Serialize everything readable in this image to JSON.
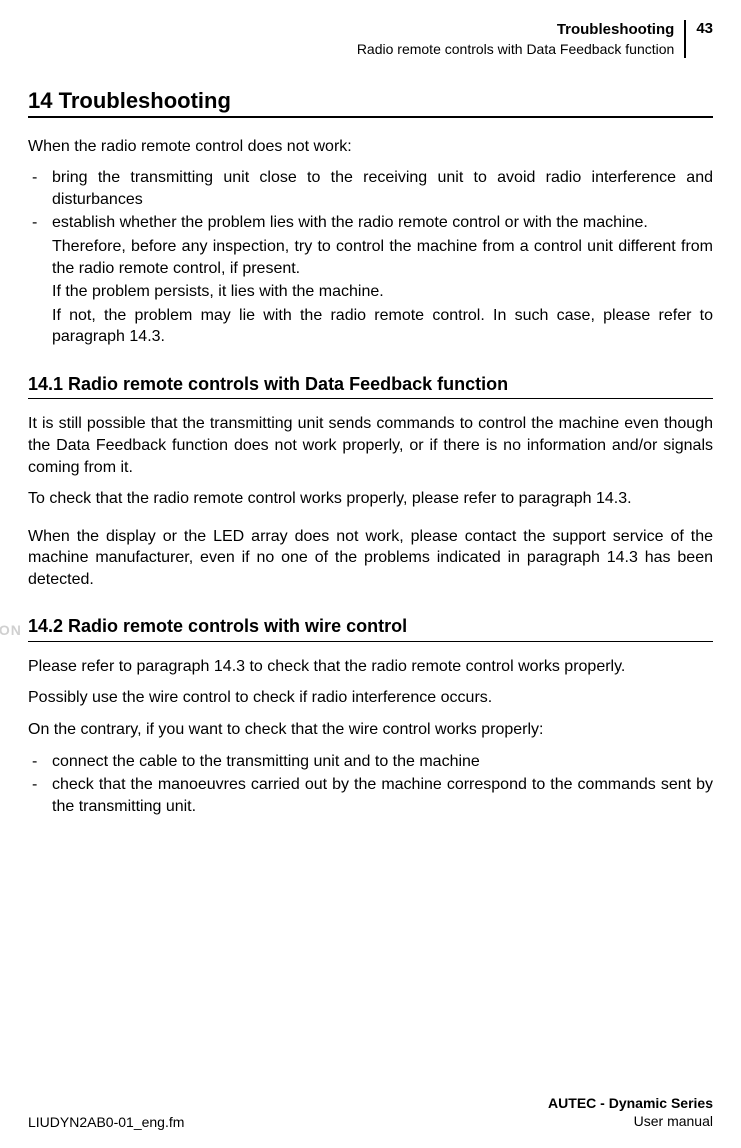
{
  "header": {
    "title": "Troubleshooting",
    "subtitle": "Radio remote controls with Data Feedback function",
    "page_number": "43"
  },
  "section": {
    "number": "14",
    "title": "Troubleshooting",
    "intro": "When the radio remote control does not work:",
    "bullets": [
      {
        "text": "bring the transmitting unit close to the receiving unit to avoid radio interference and disturbances"
      },
      {
        "text": "establish whether the problem lies with the radio remote control or with the machine.",
        "subs": [
          "Therefore, before any inspection, try to control the machine from a control unit different from the radio remote control, if present.",
          "If the problem persists, it lies with the machine.",
          "If not, the problem may lie with the radio remote control. In such case, please refer to paragraph 14.3."
        ]
      }
    ]
  },
  "sub1": {
    "heading": "14.1 Radio remote controls with Data Feedback function",
    "p1": "It is still possible that the transmitting unit sends commands to control the machine even though the Data Feedback function does not work properly, or if there is no information and/or signals coming from it.",
    "p2": "To check that the radio remote control works properly, please refer to paragraph 14.3.",
    "p3": "When the display or the LED array does not work, please contact the support service of the machine manufacturer, even if no one of the problems indicated in paragraph 14.3 has been detected."
  },
  "sub2": {
    "heading": "14.2 Radio remote controls with wire control",
    "p1": "Please refer to paragraph 14.3 to check that the radio remote control works properly.",
    "p2": "Possibly use the wire control to check if radio interference occurs.",
    "p3": "On the contrary, if you want to check that the wire control works properly:",
    "bullets": [
      "connect the cable to the transmitting unit and to the machine",
      "check that the manoeuvres carried out by the machine correspond to the commands sent by the transmitting unit."
    ]
  },
  "watermark": "ION",
  "footer": {
    "left": "LIUDYN2AB0-01_eng.fm",
    "right_title": "AUTEC - Dynamic Series",
    "right_sub": "User manual"
  }
}
